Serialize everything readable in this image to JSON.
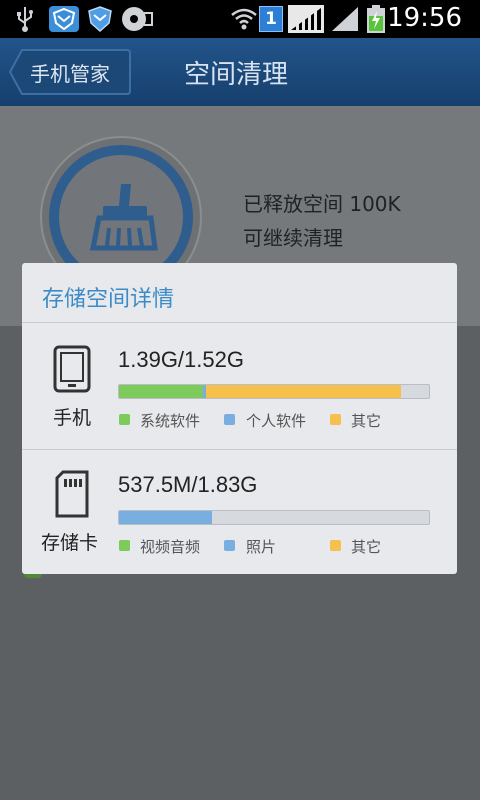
{
  "status_bar": {
    "time": "19:56",
    "sim_badge": "1",
    "icons": [
      "usb-icon",
      "security-shield-icon",
      "shield-icon",
      "disk-icon",
      "wifi-icon",
      "signal-icon",
      "signal-icon",
      "battery-charging-icon"
    ]
  },
  "header": {
    "back_label": "手机管家",
    "title": "空间清理"
  },
  "background_card": {
    "freed_text": "已释放空间 100K",
    "continue_text": "可继续清理"
  },
  "dialog": {
    "title": "存储空间详情",
    "phone": {
      "label": "手机",
      "capacity": "1.39G/1.52G",
      "usage": [
        {
          "name": "系统软件",
          "fraction": 0.27,
          "color": "#7ccb5b"
        },
        {
          "name": "个人软件",
          "fraction": 0.01,
          "color": "#79aee0"
        },
        {
          "name": "其它",
          "fraction": 0.63,
          "color": "#f6c04d"
        }
      ]
    },
    "sdcard": {
      "label": "存储卡",
      "capacity": "537.5M/1.83G",
      "usage": [
        {
          "name": "视频音频",
          "fraction": 0.0,
          "color": "#7ccb5b"
        },
        {
          "name": "照片",
          "fraction": 0.3,
          "color": "#79aee0"
        },
        {
          "name": "其它",
          "fraction": 0.0,
          "color": "#f6c04d"
        }
      ]
    }
  }
}
